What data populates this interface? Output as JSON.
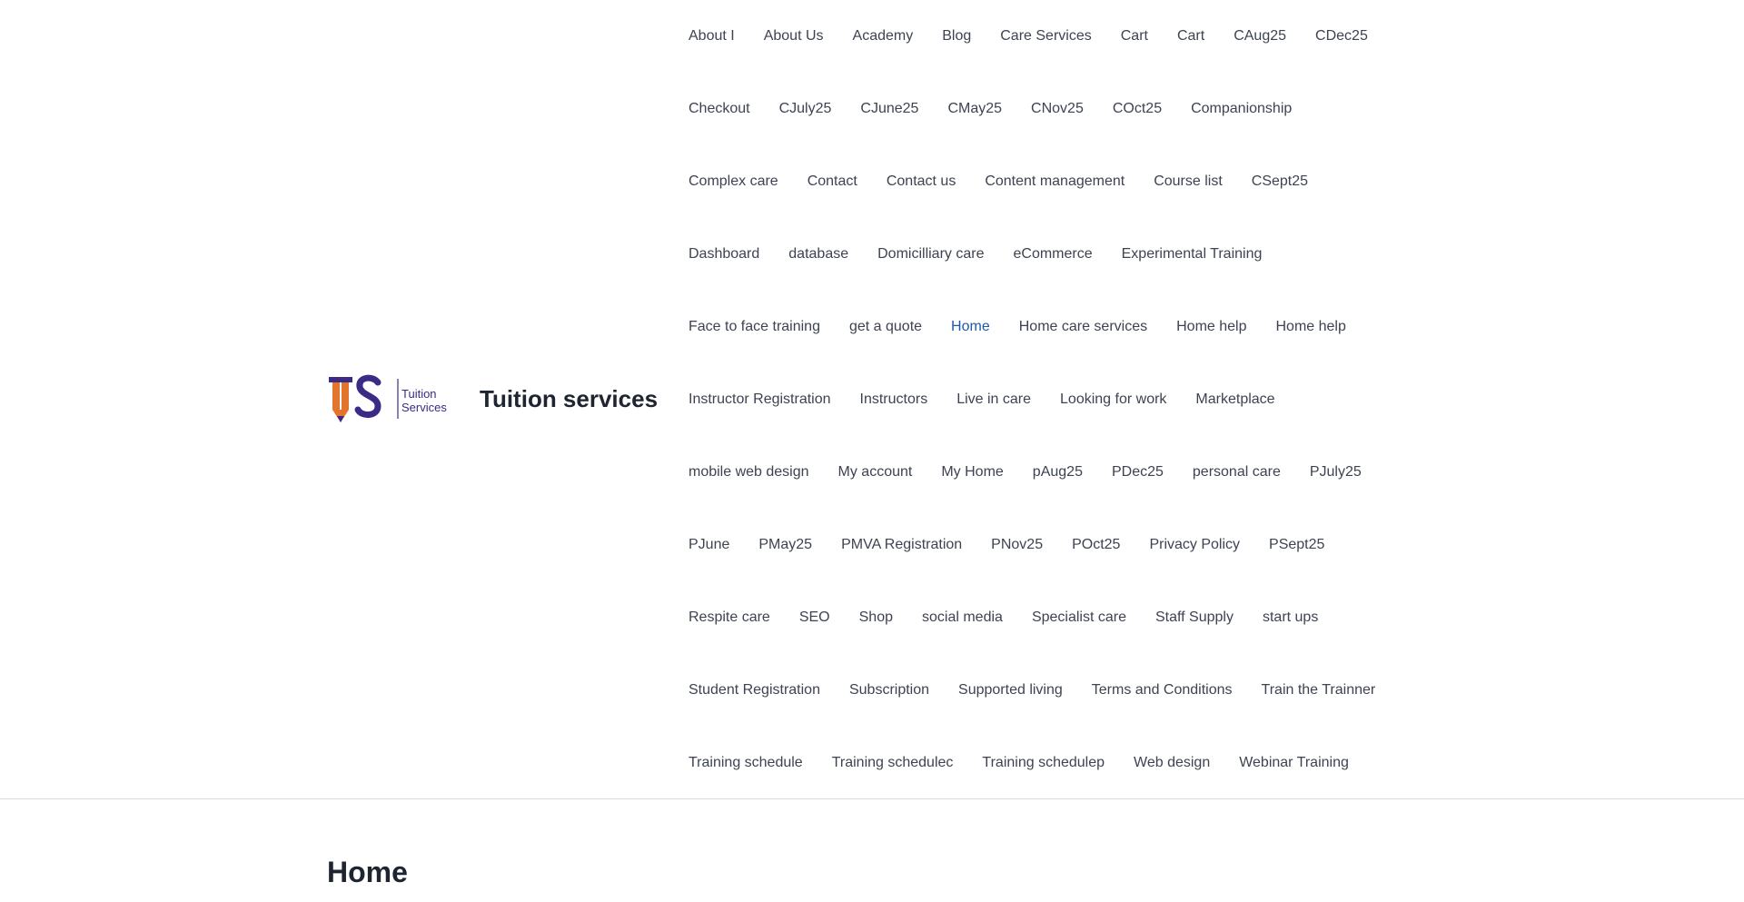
{
  "site": {
    "logo_text": "Tuition Services",
    "logo_monogram": "TS",
    "title": "Tuition services"
  },
  "nav": {
    "current": "Home",
    "rows": [
      [
        "About I",
        "About Us",
        "Academy",
        "Blog",
        "Care Services",
        "Cart",
        "Cart",
        "CAug25",
        "CDec25"
      ],
      [
        "Checkout",
        "CJuly25",
        "CJune25",
        "CMay25",
        "CNov25",
        "COct25",
        "Companionship"
      ],
      [
        "Complex care",
        "Contact",
        "Contact us",
        "Content management",
        "Course list",
        "CSept25"
      ],
      [
        "Dashboard",
        "database",
        "Domicilliary care",
        "eCommerce",
        "Experimental Training"
      ],
      [
        "Face to face training",
        "get a quote",
        "Home",
        "Home care services",
        "Home help",
        "Home help"
      ],
      [
        "Instructor Registration",
        "Instructors",
        "Live in care",
        "Looking for work",
        "Marketplace"
      ],
      [
        "mobile web design",
        "My account",
        "My Home",
        "pAug25",
        "PDec25",
        "personal care",
        "PJuly25"
      ],
      [
        "PJune",
        "PMay25",
        "PMVA Registration",
        "PNov25",
        "POct25",
        "Privacy Policy",
        "PSept25"
      ],
      [
        "Respite care",
        "SEO",
        "Shop",
        "social media",
        "Specialist care",
        "Staff Supply",
        "start ups"
      ],
      [
        "Student Registration",
        "Subscription",
        "Supported living",
        "Terms and Conditions",
        "Train the Trainner"
      ],
      [
        "Training schedule",
        "Training schedulec",
        "Training schedulep",
        "Web design",
        "Webinar Training"
      ]
    ]
  },
  "page": {
    "title": "Home"
  },
  "colors": {
    "accent": "#1d5aa8",
    "logo_purple": "#3b2a86",
    "logo_orange": "#e3742b",
    "text": "#3d4350"
  }
}
